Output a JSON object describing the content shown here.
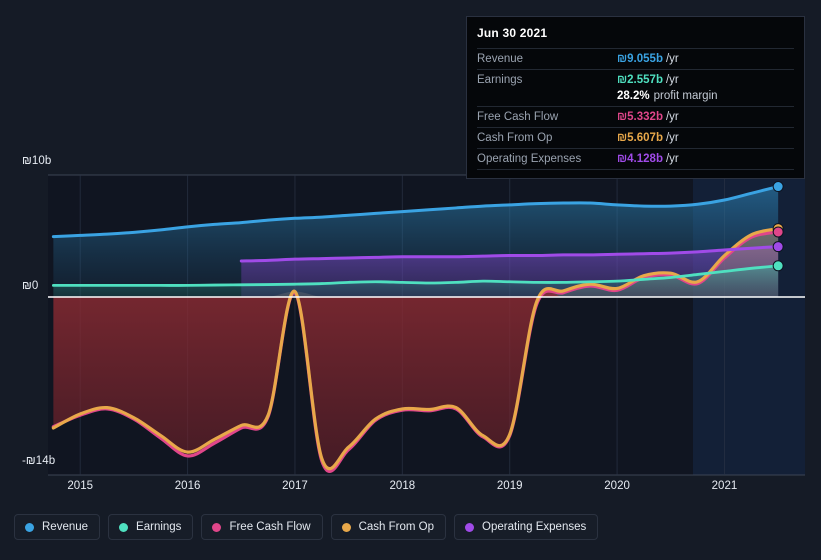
{
  "chart_data": {
    "type": "line",
    "title": "",
    "xlabel": "",
    "ylabel": "",
    "currency_symbol": "₪",
    "x_ticks": [
      "2015",
      "2016",
      "2017",
      "2018",
      "2019",
      "2020",
      "2021"
    ],
    "y_ticks": [
      "₪10b",
      "₪0",
      "-₪14b"
    ],
    "ylim": [
      -14,
      10
    ],
    "xlim": [
      2014.7,
      2021.75
    ],
    "grid": true,
    "legend_position": "bottom",
    "x": [
      2014.75,
      2015.0,
      2015.25,
      2015.5,
      2015.75,
      2016.0,
      2016.25,
      2016.5,
      2016.75,
      2017.0,
      2017.25,
      2017.5,
      2017.75,
      2018.0,
      2018.25,
      2018.5,
      2018.75,
      2019.0,
      2019.25,
      2019.5,
      2019.75,
      2020.0,
      2020.25,
      2020.5,
      2020.75,
      2021.0,
      2021.25,
      2021.5
    ],
    "series": [
      {
        "name": "Revenue",
        "color": "#3aa3e3",
        "values": [
          4.95,
          5.05,
          5.15,
          5.3,
          5.5,
          5.75,
          5.95,
          6.1,
          6.3,
          6.45,
          6.55,
          6.7,
          6.85,
          7.0,
          7.15,
          7.3,
          7.45,
          7.55,
          7.65,
          7.7,
          7.7,
          7.55,
          7.45,
          7.45,
          7.6,
          7.95,
          8.5,
          9.055
        ],
        "end_value": 9.055
      },
      {
        "name": "Earnings",
        "color": "#4fe0c0",
        "values": [
          0.95,
          0.95,
          0.95,
          0.95,
          0.95,
          0.95,
          0.98,
          1.0,
          1.02,
          1.05,
          1.1,
          1.2,
          1.25,
          1.2,
          1.15,
          1.2,
          1.3,
          1.25,
          1.2,
          1.2,
          1.25,
          1.3,
          1.45,
          1.6,
          1.85,
          2.1,
          2.35,
          2.557
        ],
        "end_value": 2.557
      },
      {
        "name": "Free Cash Flow",
        "color": "#e0468a",
        "values": [
          -10.2,
          -9.3,
          -8.8,
          -9.6,
          -11.1,
          -12.5,
          -11.5,
          -10.3,
          -9.4,
          0.35,
          -12.9,
          -12.0,
          -9.7,
          -8.9,
          -8.95,
          -8.8,
          -11.0,
          -10.9,
          -0.6,
          0.35,
          0.9,
          0.55,
          1.6,
          1.8,
          1.1,
          3.2,
          4.9,
          5.332
        ],
        "end_value": 5.332
      },
      {
        "name": "Cash From Op",
        "color": "#e8a84a",
        "values": [
          -10.3,
          -9.2,
          -8.7,
          -9.5,
          -10.9,
          -12.2,
          -11.2,
          -10.1,
          -9.3,
          0.45,
          -12.7,
          -11.8,
          -9.6,
          -8.8,
          -8.85,
          -8.7,
          -10.9,
          -10.8,
          -0.4,
          0.5,
          1.05,
          0.7,
          1.75,
          1.95,
          1.25,
          3.4,
          5.1,
          5.607
        ],
        "end_value": 5.607
      },
      {
        "name": "Operating Expenses",
        "color": "#a04be8",
        "start_x": 2016.5,
        "values": [
          null,
          null,
          null,
          null,
          null,
          null,
          null,
          2.95,
          3.0,
          3.1,
          3.15,
          3.2,
          3.25,
          3.3,
          3.3,
          3.3,
          3.35,
          3.4,
          3.4,
          3.45,
          3.45,
          3.5,
          3.55,
          3.6,
          3.7,
          3.85,
          4.0,
          4.128
        ],
        "end_value": 4.128
      }
    ]
  },
  "tooltip": {
    "date": "Jun 30 2021",
    "rows": [
      {
        "label": "Revenue",
        "value": "₪9.055b",
        "unit": "/yr",
        "color": "#3aa3e3"
      },
      {
        "label": "Earnings",
        "value": "₪2.557b",
        "unit": "/yr",
        "color": "#4fe0c0"
      },
      {
        "label": "Free Cash Flow",
        "value": "₪5.332b",
        "unit": "/yr",
        "color": "#e0468a"
      },
      {
        "label": "Cash From Op",
        "value": "₪5.607b",
        "unit": "/yr",
        "color": "#e8a84a"
      },
      {
        "label": "Operating Expenses",
        "value": "₪4.128b",
        "unit": "/yr",
        "color": "#a04be8"
      }
    ],
    "profit_margin_value": "28.2%",
    "profit_margin_text": "profit margin"
  },
  "legend": {
    "items": [
      {
        "label": "Revenue",
        "color": "#3aa3e3"
      },
      {
        "label": "Earnings",
        "color": "#4fe0c0"
      },
      {
        "label": "Free Cash Flow",
        "color": "#e0468a"
      },
      {
        "label": "Cash From Op",
        "color": "#e8a84a"
      },
      {
        "label": "Operating Expenses",
        "color": "#a04be8"
      }
    ]
  },
  "axis": {
    "y_top": "₪10b",
    "y_zero": "₪0",
    "y_bottom": "-₪14b",
    "x": [
      "2015",
      "2016",
      "2017",
      "2018",
      "2019",
      "2020",
      "2021"
    ]
  }
}
